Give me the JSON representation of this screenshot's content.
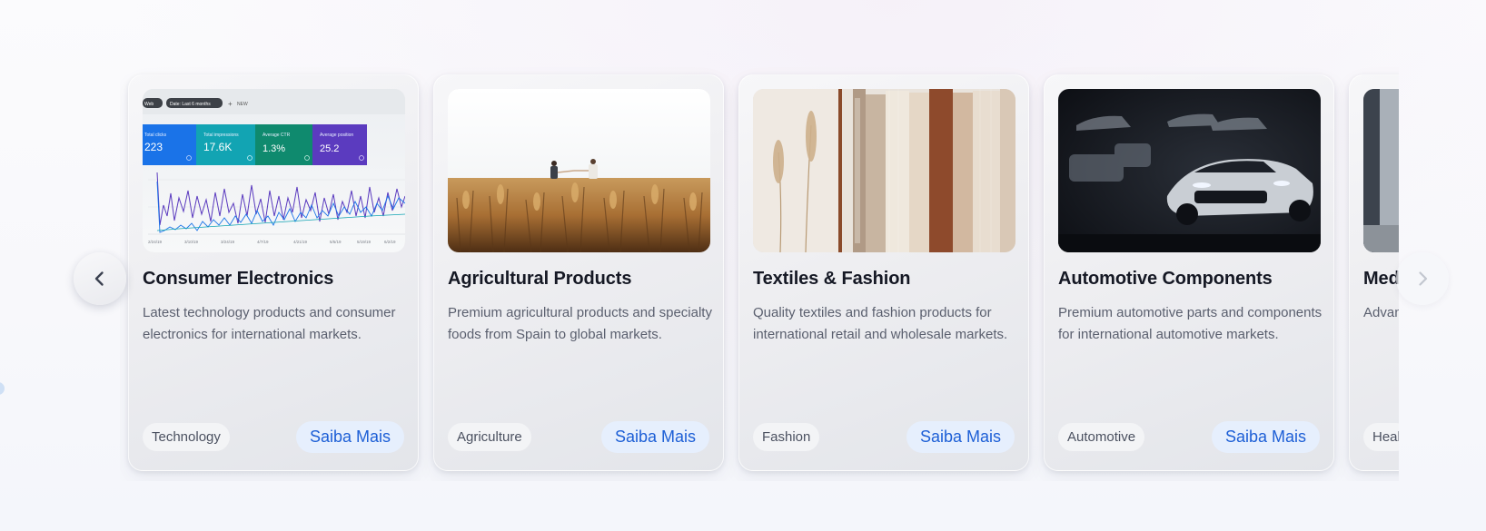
{
  "carousel": {
    "prev_icon": "chevron-left-icon",
    "next_icon": "chevron-right-icon",
    "accent_color": "#1d5fd6",
    "cards": [
      {
        "title": "Consumer Electronics",
        "description": "Latest technology products and consumer electronics for international markets.",
        "tag": "Technology",
        "cta": "Saiba Mais",
        "image": "analytics-dashboard-photo",
        "dashboard": {
          "filter_chip_1": "Web",
          "filter_chip_2": "Date: Last 6 months",
          "new_label": "NEW",
          "metrics": [
            {
              "label": "Total clicks",
              "value": "223"
            },
            {
              "label": "Total impressions",
              "value": "17.6K"
            },
            {
              "label": "Average CTR",
              "value": "1.3%"
            },
            {
              "label": "Average position",
              "value": "25.2"
            }
          ],
          "x_ticks": [
            "2/24/19",
            "3/10/19",
            "3/24/19",
            "4/7/19",
            "4/21/19",
            "5/5/19",
            "5/19/19",
            "6/2/19"
          ]
        }
      },
      {
        "title": "Agricultural Products",
        "description": "Premium agricultural products and specialty foods from Spain to global markets.",
        "tag": "Agriculture",
        "cta": "Saiba Mais",
        "image": "wheat-field-photo"
      },
      {
        "title": "Textiles & Fashion",
        "description": "Quality textiles and fashion products for international retail and wholesale markets.",
        "tag": "Fashion",
        "cta": "Saiba Mais",
        "image": "clothing-rack-photo"
      },
      {
        "title": "Automotive Components",
        "description": "Premium automotive parts and components for international automotive markets.",
        "tag": "Automotive",
        "cta": "Saiba Mais",
        "image": "sports-car-photo"
      },
      {
        "title": "Med",
        "description": "Advan health",
        "tag": "Heal",
        "cta": "",
        "image": "medical-photo"
      }
    ]
  }
}
